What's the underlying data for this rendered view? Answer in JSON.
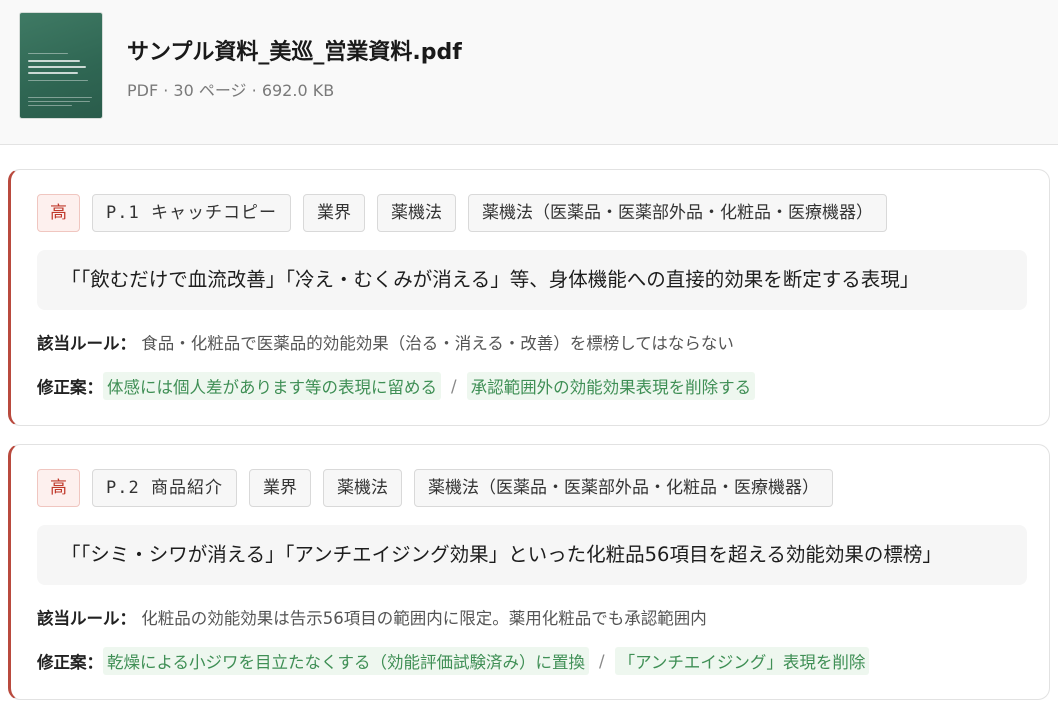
{
  "file": {
    "name": "サンプル資料_美巡_営業資料.pdf",
    "meta": "PDF · 30 ページ · 692.0 KB"
  },
  "labels": {
    "rule": "該当ルール：",
    "fix": "修正案："
  },
  "colors": {
    "severity_high": "#b94a3e",
    "suggestion_text": "#3f8f55",
    "suggestion_bg": "#eef7ef",
    "thumbnail": "#2f6653"
  },
  "findings": [
    {
      "severity": "高",
      "page_tag": "P.1 キャッチコピー",
      "category": "業界",
      "law": "薬機法",
      "law_detail": "薬機法（医薬品・医薬部外品・化粧品・医療機器）",
      "quote": "「「飲むだけで血流改善」「冷え・むくみが消える」等、身体機能への直接的効果を断定する表現」",
      "rule": "食品・化粧品で医薬品的効能効果（治る・消える・改善）を標榜してはならない",
      "fixes": [
        "体感には個人差があります等の表現に留める",
        "承認範囲外の効能効果表現を削除する"
      ]
    },
    {
      "severity": "高",
      "page_tag": "P.2 商品紹介",
      "category": "業界",
      "law": "薬機法",
      "law_detail": "薬機法（医薬品・医薬部外品・化粧品・医療機器）",
      "quote": "「「シミ・シワが消える」「アンチエイジング効果」といった化粧品56項目を超える効能効果の標榜」",
      "rule": "化粧品の効能効果は告示56項目の範囲内に限定。薬用化粧品でも承認範囲内",
      "fixes": [
        "乾燥による小ジワを目立たなくする（効能評価試験済み）に置換",
        "「アンチエイジング」表現を削除"
      ]
    }
  ]
}
